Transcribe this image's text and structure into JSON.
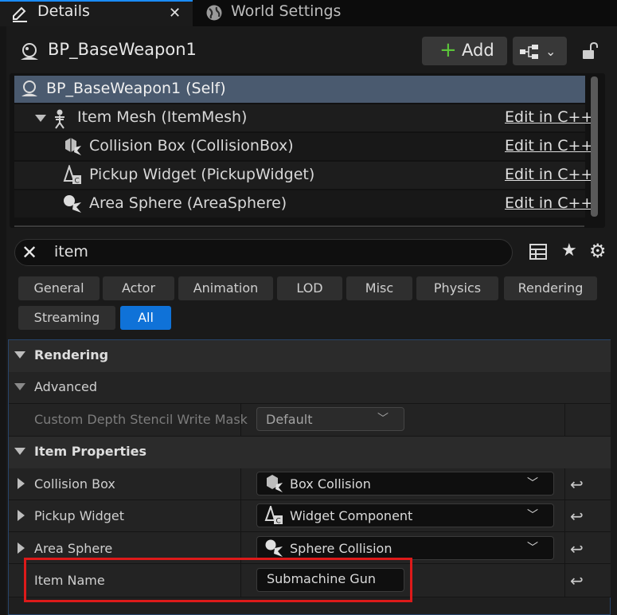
{
  "tabs": [
    {
      "label": "Details",
      "active": true
    },
    {
      "label": "World Settings",
      "active": false
    }
  ],
  "header": {
    "title": "BP_BaseWeapon1",
    "add_label": "Add"
  },
  "tree": {
    "items": [
      {
        "label": "BP_BaseWeapon1 (Self)",
        "selected": true
      },
      {
        "label": "Item Mesh (ItemMesh)",
        "link": "Edit in C++",
        "icon": "skeletal-mesh-icon"
      },
      {
        "label": "Collision Box (CollisionBox)",
        "link": "Edit in C++",
        "icon": "box-collision-icon"
      },
      {
        "label": "Pickup Widget (PickupWidget)",
        "link": "Edit in C++",
        "icon": "widget-component-icon"
      },
      {
        "label": "Area Sphere (AreaSphere)",
        "link": "Edit in C++",
        "icon": "sphere-collision-icon"
      }
    ]
  },
  "search": {
    "value": "item"
  },
  "filters": [
    "General",
    "Actor",
    "Animation",
    "LOD",
    "Misc",
    "Physics",
    "Rendering",
    "Streaming",
    "All"
  ],
  "active_filter": "All",
  "properties": {
    "rendering_cat": "Rendering",
    "advanced": "Advanced",
    "stencil_label": "Custom Depth Stencil Write Mask",
    "stencil_value": "Default",
    "item_props_cat": "Item Properties",
    "collision_box_label": "Collision Box",
    "collision_box_value": "Box Collision",
    "pickup_widget_label": "Pickup Widget",
    "pickup_widget_value": "Widget Component",
    "area_sphere_label": "Area Sphere",
    "area_sphere_value": "Sphere Collision",
    "item_name_label": "Item Name",
    "item_name_value": "Submachine Gun"
  },
  "colors": {
    "accent": "#0f72d8",
    "selection": "#4a5a6f",
    "highlight": "#dd1a1a",
    "add_plus": "#5cc63a"
  }
}
